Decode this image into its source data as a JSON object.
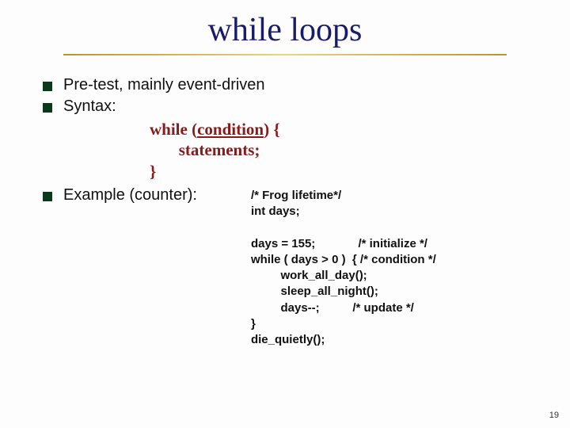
{
  "title": {
    "part1": "while",
    "part2": " loops"
  },
  "bullets": {
    "b1": "Pre-test, mainly event-driven",
    "b2": "Syntax:",
    "b3": "Example (counter):"
  },
  "syntax": {
    "line1_pre": "while (",
    "line1_cond": "condition",
    "line1_post": ")  {",
    "line2": "       statements;",
    "line3": "}"
  },
  "code": {
    "text": "/* Frog lifetime*/\nint days;\n\ndays = 155;             /* initialize */\nwhile ( days > 0 )  { /* condition */\n         work_all_day();\n         sleep_all_night();\n         days--;          /* update */\n}\ndie_quietly();"
  },
  "page_number": "19"
}
